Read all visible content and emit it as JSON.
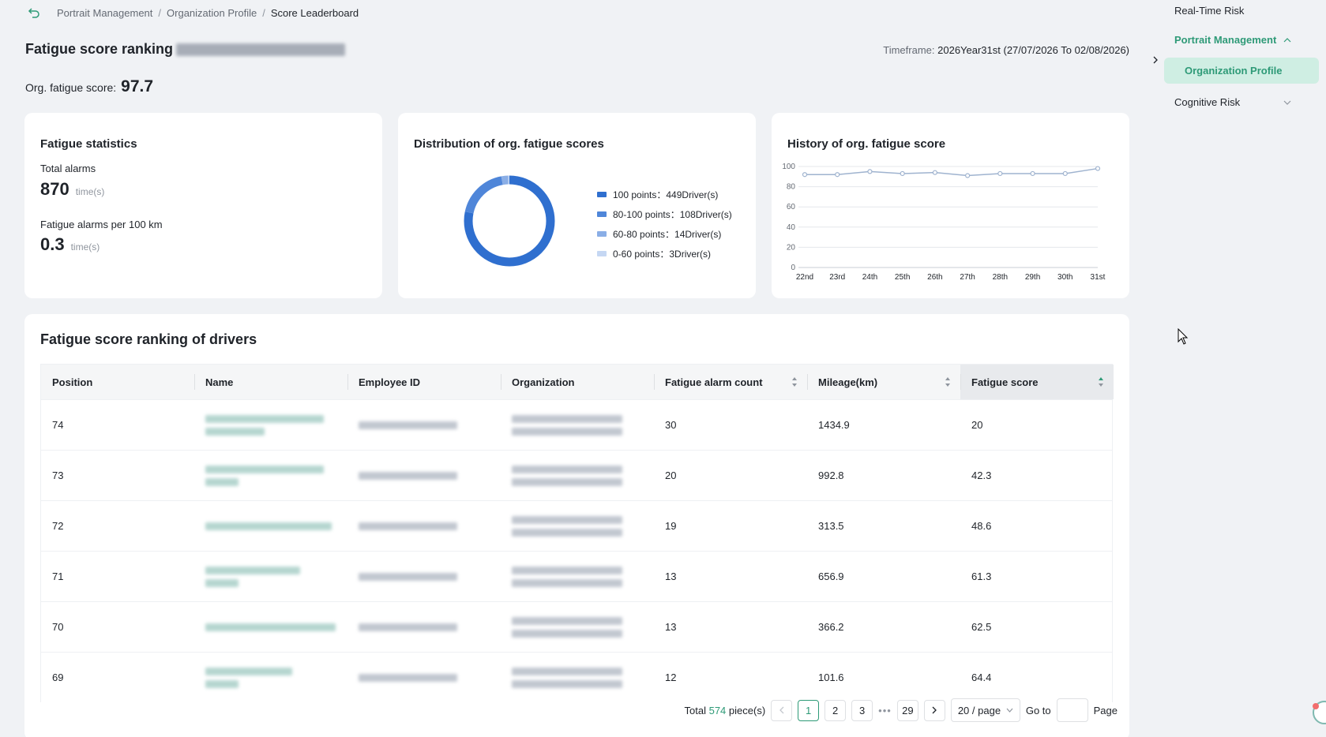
{
  "breadcrumb": {
    "items": [
      "Portrait Management",
      "Organization Profile",
      "Score Leaderboard"
    ],
    "separator": "/"
  },
  "header": {
    "title": "Fatigue score ranking",
    "timeframe_label": "Timeframe:",
    "timeframe_value": "2026Year31st (27/07/2026 To 02/08/2026)",
    "org_score_label": "Org. fatigue score:",
    "org_score_value": "97.7"
  },
  "stats_card": {
    "title": "Fatigue statistics",
    "total_alarms_label": "Total alarms",
    "total_alarms_value": "870",
    "total_alarms_unit": "time(s)",
    "per100_label": "Fatigue alarms per 100 km",
    "per100_value": "0.3",
    "per100_unit": "time(s)"
  },
  "dist_card": {
    "title": "Distribution of org. fatigue scores",
    "legend": [
      {
        "label": "100 points：449Driver(s)",
        "color": "#2f6fcf"
      },
      {
        "label": "80-100 points：108Driver(s)",
        "color": "#4f86d9"
      },
      {
        "label": "60-80 points：14Driver(s)",
        "color": "#8aaee6"
      },
      {
        "label": "0-60 points：3Driver(s)",
        "color": "#c5d7f3"
      }
    ]
  },
  "hist_card": {
    "title": "History of org. fatigue score"
  },
  "chart_data": [
    {
      "type": "pie",
      "title": "Distribution of org. fatigue scores",
      "categories": [
        "100 points",
        "80-100 points",
        "60-80 points",
        "0-60 points"
      ],
      "values": [
        449,
        108,
        14,
        3
      ],
      "colors": [
        "#2f6fcf",
        "#4f86d9",
        "#8aaee6",
        "#c5d7f3"
      ],
      "legend": "right"
    },
    {
      "type": "line",
      "title": "History of org. fatigue score",
      "categories": [
        "22nd",
        "23rd",
        "24th",
        "25th",
        "26th",
        "27th",
        "28th",
        "29th",
        "30th",
        "31st"
      ],
      "series": [
        {
          "values": [
            92,
            92,
            95,
            93,
            94,
            91,
            93,
            93,
            93,
            98
          ]
        }
      ],
      "ylim": [
        0,
        100
      ],
      "yticks": [
        0,
        20,
        40,
        60,
        80,
        100
      ],
      "grid": true,
      "color": "#9fb3cf"
    }
  ],
  "table": {
    "title": "Fatigue score ranking of drivers",
    "columns": [
      "Position",
      "Name",
      "Employee ID",
      "Organization",
      "Fatigue alarm count",
      "Mileage(km)",
      "Fatigue score"
    ],
    "rows": [
      {
        "position": "74",
        "alarms": "30",
        "mileage": "1434.9",
        "score": "20"
      },
      {
        "position": "73",
        "alarms": "20",
        "mileage": "992.8",
        "score": "42.3"
      },
      {
        "position": "72",
        "alarms": "19",
        "mileage": "313.5",
        "score": "48.6"
      },
      {
        "position": "71",
        "alarms": "13",
        "mileage": "656.9",
        "score": "61.3"
      },
      {
        "position": "70",
        "alarms": "13",
        "mileage": "366.2",
        "score": "62.5"
      },
      {
        "position": "69",
        "alarms": "12",
        "mileage": "101.6",
        "score": "64.4"
      }
    ]
  },
  "pager": {
    "total_prefix": "Total",
    "total_count": "574",
    "total_suffix": "piece(s)",
    "pages": [
      "1",
      "2",
      "3",
      "29"
    ],
    "ellipsis": "•••",
    "page_size": "20 / page",
    "goto_label": "Go to",
    "page_label": "Page"
  },
  "sidebar": {
    "realtime": "Real-Time Risk",
    "portrait": "Portrait Management",
    "org_profile": "Organization Profile",
    "cognitive": "Cognitive Risk"
  },
  "colors": {
    "accent": "#2e9a77",
    "accent_bg": "#cfeee3",
    "donut_primary": "#2f6fcf"
  }
}
